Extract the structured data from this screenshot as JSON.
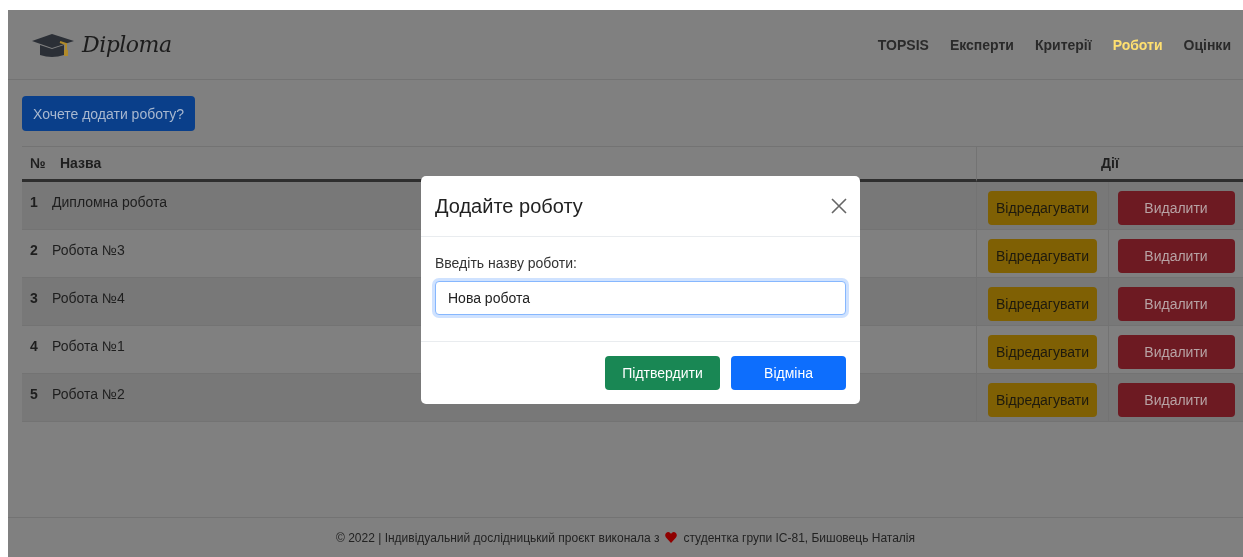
{
  "brand": {
    "name": "Diploma"
  },
  "nav": [
    {
      "label": "TOPSIS",
      "selected": false
    },
    {
      "label": "Експерти",
      "selected": false
    },
    {
      "label": "Критерії",
      "selected": false
    },
    {
      "label": "Роботи",
      "selected": true
    },
    {
      "label": "Оцінки",
      "selected": false
    }
  ],
  "add_button": "Хочете додати роботу?",
  "table": {
    "columns": [
      "№",
      "Назва",
      "Дії"
    ],
    "rows": [
      {
        "number": "1",
        "name": "Дипломна робота",
        "edit": "Відредагувати",
        "delete": "Видалити"
      },
      {
        "number": "2",
        "name": "Робота №3",
        "edit": "Відредагувати",
        "delete": "Видалити"
      },
      {
        "number": "3",
        "name": "Робота №4",
        "edit": "Відредагувати",
        "delete": "Видалити"
      },
      {
        "number": "4",
        "name": "Робота №1",
        "edit": "Відредагувати",
        "delete": "Видалити"
      },
      {
        "number": "5",
        "name": "Робота №2",
        "edit": "Відредагувати",
        "delete": "Видалити"
      }
    ]
  },
  "modal": {
    "title": "Додайте роботу",
    "field_label": "Введіть назву роботи:",
    "field_value": "Нова робота",
    "buttons": [
      {
        "label": "Підтвердити",
        "kind": "confirm"
      },
      {
        "label": "Відміна",
        "kind": "cancel"
      }
    ]
  },
  "footer": {
    "text_before": "© 2022 | Індивідуальний дослідницький проєкт виконала з",
    "text_after": "студентка групи ІС-81, Бишовець Наталія"
  }
}
